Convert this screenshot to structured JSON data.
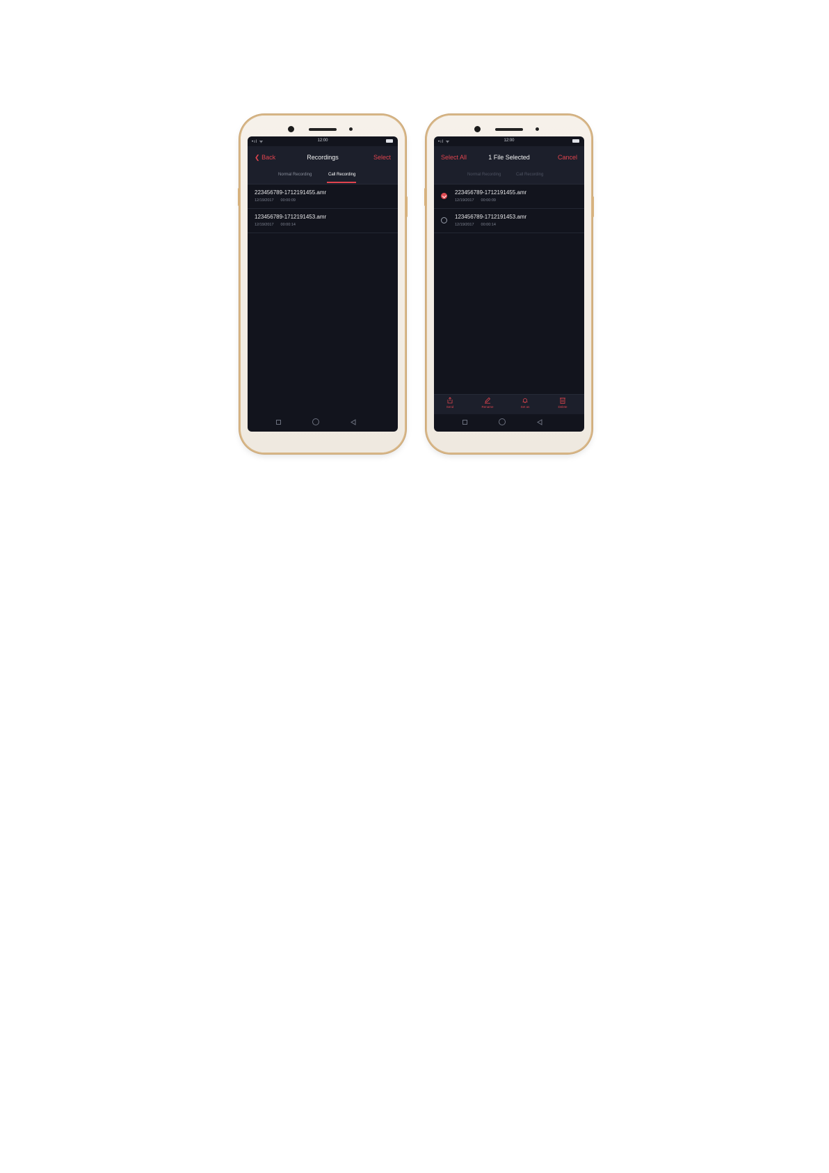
{
  "left_phone": {
    "status": {
      "signal": "•ıl ᯤ",
      "time": "12:00"
    },
    "header": {
      "back_label": "Back",
      "title": "Recordings",
      "select_label": "Select"
    },
    "tabs": [
      {
        "label": "Normal Recording",
        "active": false
      },
      {
        "label": "Call Recording",
        "active": true
      }
    ],
    "recordings": [
      {
        "name": "223456789-1712191455.amr",
        "date": "12/19/2017",
        "duration": "00:00:09"
      },
      {
        "name": "123456789-1712191453.amr",
        "date": "12/19/2017",
        "duration": "00:00:14"
      }
    ]
  },
  "right_phone": {
    "status": {
      "signal": "•ıl ᯤ",
      "time": "12:00"
    },
    "header": {
      "select_all_label": "Select All",
      "title": "1 File Selected",
      "cancel_label": "Cancel"
    },
    "tabs": [
      {
        "label": "Normal Recording",
        "active": false
      },
      {
        "label": "Call Recording",
        "active": false
      }
    ],
    "recordings": [
      {
        "name": "223456789-1712191455.amr",
        "date": "12/19/2017",
        "duration": "00:00:09",
        "selected": true
      },
      {
        "name": "123456789-1712191453.amr",
        "date": "12/19/2017",
        "duration": "00:00:14",
        "selected": false
      }
    ],
    "actions": [
      {
        "label": "Send",
        "icon": "share-icon"
      },
      {
        "label": "Rename",
        "icon": "pencil-icon"
      },
      {
        "label": "Set as",
        "icon": "bell-icon"
      },
      {
        "label": "Delete",
        "icon": "trash-icon"
      }
    ]
  },
  "colors": {
    "accent": "#e0444e",
    "screen_bg": "#12141d",
    "header_bg": "#1c1f2b",
    "phone_body": "#f3eee6",
    "phone_rim": "#d9b889"
  }
}
